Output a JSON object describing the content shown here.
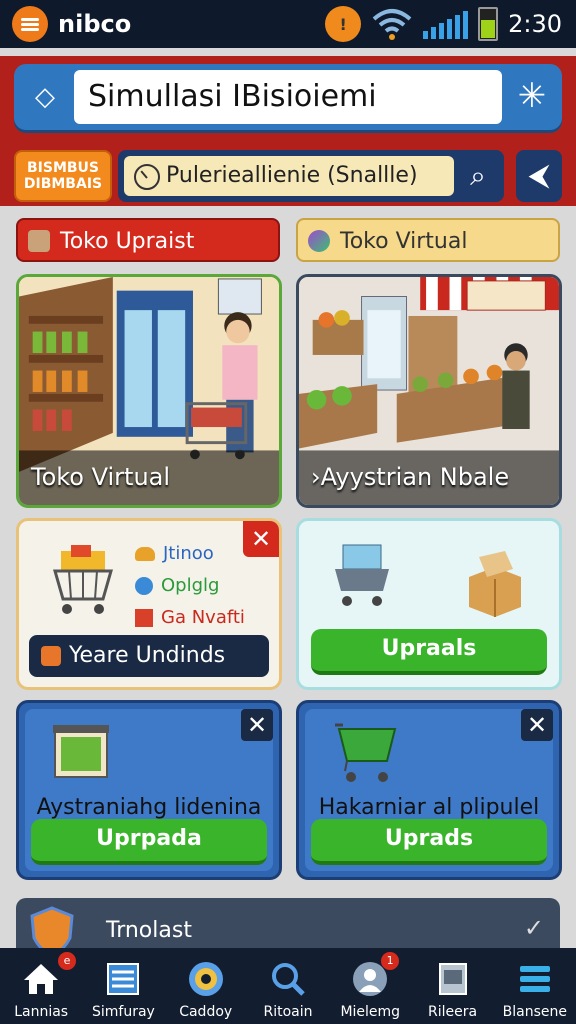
{
  "status": {
    "app_name": "nibco",
    "time": "2:30"
  },
  "search": {
    "value": "Simullasi IBisioiemi"
  },
  "header": {
    "badge": "BISMBUS DIBMBAIS",
    "filter_value": "Pulerieallienie (Snallle)"
  },
  "tabs": [
    {
      "label": "Toko Upraist"
    },
    {
      "label": "Toko Virtual"
    }
  ],
  "cards": {
    "store_left": {
      "label": "Toko Virtual"
    },
    "store_right": {
      "label": "›Ayystrian Nbale"
    },
    "cart": {
      "items": [
        "Jtinoo",
        "Oplglg",
        "Ga Nvafti"
      ],
      "label": "Yeare Undinds"
    },
    "box": {
      "button": "Upraals"
    },
    "basket": {
      "title": "Aystraniahg lidenina",
      "button": "Uprpada"
    },
    "trolley": {
      "title": "Hakarniar al plipulel",
      "button": "Uprads"
    }
  },
  "bottom_panel": {
    "label": "Trnolast"
  },
  "nav": [
    {
      "label": "Lannias",
      "icon": "home-icon",
      "badge": "e"
    },
    {
      "label": "Simfuray",
      "icon": "list-icon"
    },
    {
      "label": "Caddoy",
      "icon": "coin-icon"
    },
    {
      "label": "Ritoain",
      "icon": "magnifier-icon"
    },
    {
      "label": "Mielemg",
      "icon": "profile-icon",
      "badge": "1"
    },
    {
      "label": "Rileera",
      "icon": "document-icon"
    },
    {
      "label": "Blansene",
      "icon": "menu-icon"
    }
  ],
  "colors": {
    "header_red": "#b2201c",
    "search_blue": "#2f78c0",
    "accent_orange": "#f28a1e",
    "button_green": "#3ab42a",
    "nav_dark": "#121e30"
  }
}
